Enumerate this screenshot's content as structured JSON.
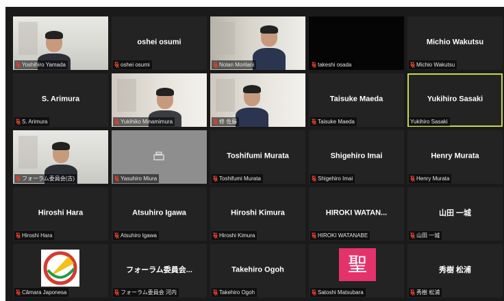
{
  "meeting": {
    "tiles": [
      {
        "id": "t1",
        "label": "Yoshihiro Yamada",
        "video": "office",
        "active": false
      },
      {
        "id": "t2",
        "label": "oshei osumi",
        "display_name": "oshei osumi",
        "video": "none",
        "active": false
      },
      {
        "id": "t3",
        "label": "Nolan Morilani",
        "video": "window",
        "active": false
      },
      {
        "id": "t4",
        "label": "takeshi osada",
        "video": "dark",
        "active": false
      },
      {
        "id": "t5",
        "label": "Michio Wakutsu",
        "display_name": "Michio Wakutsu",
        "video": "none",
        "active": false
      },
      {
        "id": "t6",
        "label": "S. Arimura",
        "display_name": "S. Arimura",
        "video": "none",
        "active": false
      },
      {
        "id": "t7",
        "label": "Yukihiko Minamimura",
        "video": "room",
        "active": false
      },
      {
        "id": "t8",
        "label": "修 佐藤",
        "video": "room",
        "active": false
      },
      {
        "id": "t9",
        "label": "Taisuke Maeda",
        "display_name": "Taisuke Maeda",
        "video": "none",
        "active": false
      },
      {
        "id": "t10",
        "label": "Yukihiro Sasaki",
        "display_name": "Yukihiro Sasaki",
        "video": "none",
        "active": true
      },
      {
        "id": "t11",
        "label": "フォーラム委員会(古)",
        "video": "office",
        "active": false
      },
      {
        "id": "t12",
        "label": "Yasuhiro Miura",
        "video": "gray",
        "active": false
      },
      {
        "id": "t13",
        "label": "Toshifumi Murata",
        "display_name": "Toshifumi Murata",
        "video": "none",
        "active": false
      },
      {
        "id": "t14",
        "label": "Shigehiro Imai",
        "display_name": "Shigehiro Imai",
        "video": "none",
        "active": false
      },
      {
        "id": "t15",
        "label": "Henry Murata",
        "display_name": "Henry Murata",
        "video": "none",
        "active": false
      },
      {
        "id": "t16",
        "label": "Hiroshi Hara",
        "display_name": "Hiroshi Hara",
        "video": "none",
        "active": false
      },
      {
        "id": "t17",
        "label": "Atsuhiro Igawa",
        "display_name": "Atsuhiro Igawa",
        "video": "none",
        "active": false
      },
      {
        "id": "t18",
        "label": "Hiroshi Kimura",
        "display_name": "Hiroshi Kimura",
        "video": "none",
        "active": false
      },
      {
        "id": "t19",
        "label": "HIROKI WATANABE",
        "display_name": "HIROKI WATAN...",
        "video": "none",
        "active": false
      },
      {
        "id": "t20",
        "label": "山田 一城",
        "display_name": "山田 一城",
        "video": "none",
        "active": false
      },
      {
        "id": "t21",
        "label": "Câmara Japonesa",
        "video": "logo",
        "active": false
      },
      {
        "id": "t22",
        "label": "フォーラム委員会 河内",
        "display_name": "フォーラム委員会...",
        "video": "none",
        "active": false
      },
      {
        "id": "t23",
        "label": "Takehiro Ogoh",
        "display_name": "Takehiro Ogoh",
        "video": "none",
        "active": false
      },
      {
        "id": "t24",
        "label": "Satoshi Matsubara",
        "avatar_text": "聖",
        "video": "avatar",
        "active": false
      },
      {
        "id": "t25",
        "label": "秀樹 松浦",
        "display_name": "秀樹 松浦",
        "video": "none",
        "active": false
      }
    ]
  },
  "colors": {
    "background": "#1a1a1a",
    "tile": "#232323",
    "active_border": "#c9d94a",
    "muted_mic": "#e0402f",
    "avatar_pink": "#e4336c"
  },
  "icons": {
    "muted": "muted-mic-icon",
    "no_video": "camera-placeholder-icon"
  }
}
